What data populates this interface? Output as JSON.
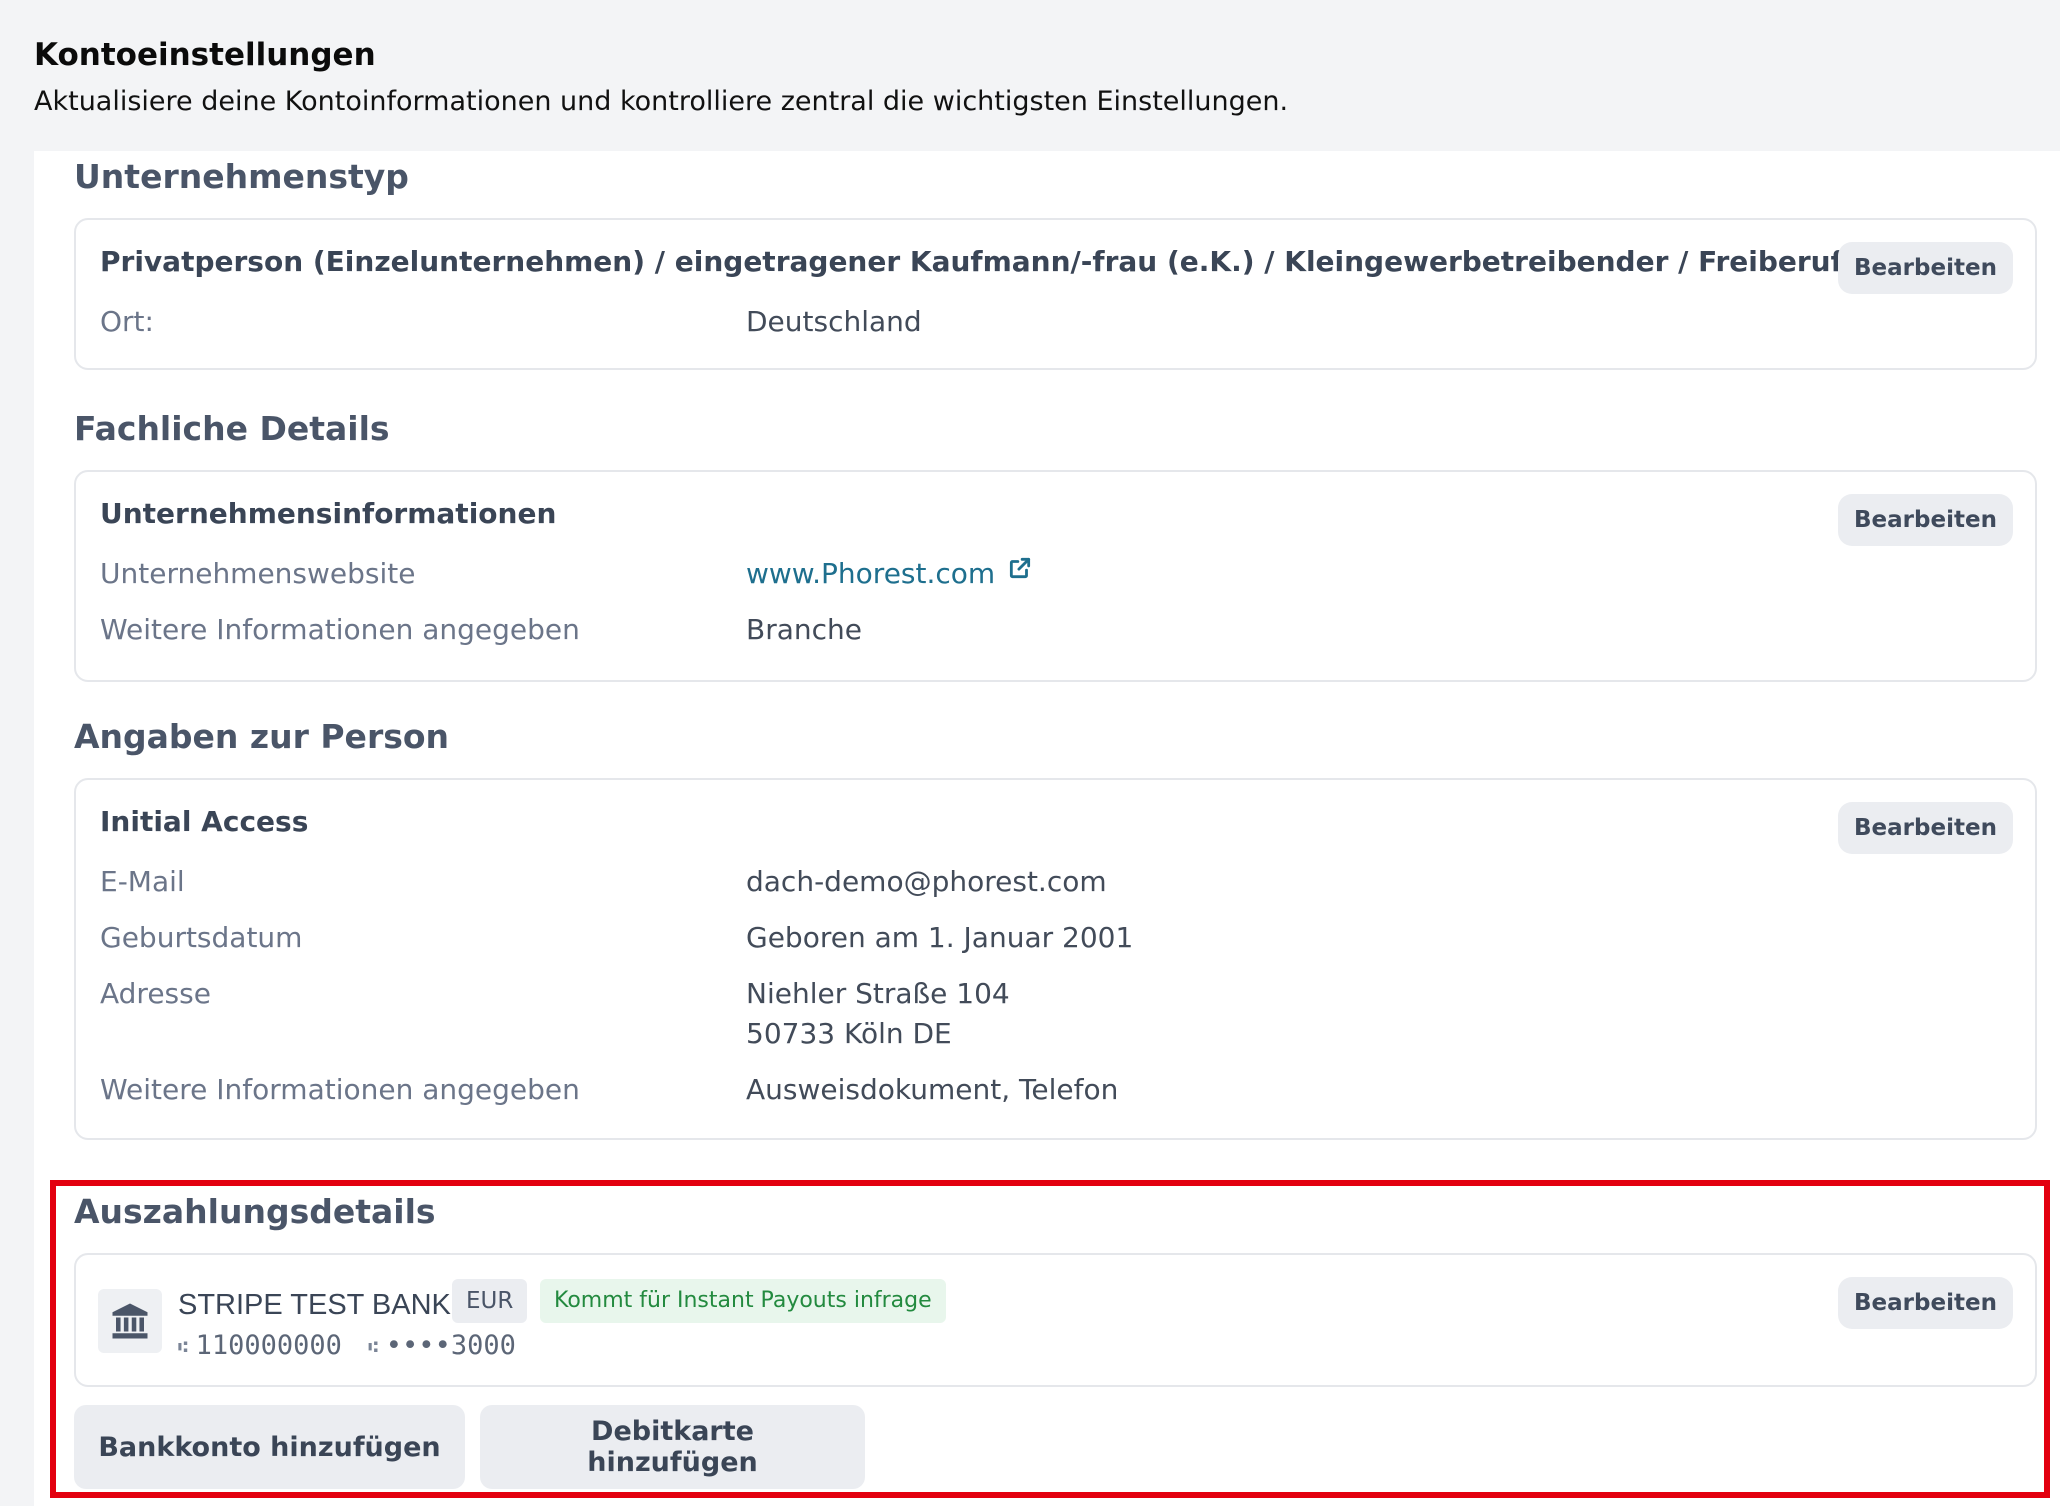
{
  "header": {
    "title": "Kontoeinstellungen",
    "subtitle": "Aktualisiere deine Kontoinformationen und kontrolliere zentral die wichtigsten Einstellungen."
  },
  "edit_label": "Bearbeiten",
  "company_type": {
    "section_title": "Unternehmenstyp",
    "heading": "Privatperson (Einzelunternehmen) / eingetragener Kaufmann/-frau (e.K.) / Kleingewerbetreibender / Freiberufler / o.ä.",
    "rows": [
      {
        "label": "Ort:",
        "value": "Deutschland"
      }
    ]
  },
  "professional_details": {
    "section_title": "Fachliche Details",
    "heading": "Unternehmensinformationen",
    "website_label": "Unternehmenswebsite",
    "website_value": "www.Phorest.com",
    "more_info_label": "Weitere Informationen angegeben",
    "more_info_value": "Branche"
  },
  "person": {
    "section_title": "Angaben zur Person",
    "heading": "Initial Access",
    "email_label": "E-Mail",
    "email_value": "dach-demo@phorest.com",
    "birth_label": "Geburtsdatum",
    "birth_value": "Geboren am 1. Januar 2001",
    "address_label": "Adresse",
    "address_line1": "Niehler Straße 104",
    "address_line2": "50733 Köln DE",
    "more_info_label": "Weitere Informationen angegeben",
    "more_info_value": "Ausweisdokument, Telefon"
  },
  "payout": {
    "section_title": "Auszahlungsdetails",
    "bank_name": "STRIPE TEST BANK",
    "currency": "EUR",
    "instant_badge": "Kommt für Instant Payouts infrage",
    "routing_number": "110000000",
    "account_masked": "••••3000",
    "add_bank_label": "Bankkonto hinzufügen",
    "add_debit_label": "Debitkarte hinzufügen"
  },
  "icons": {
    "bank": "bank-icon",
    "external_link": "external-link-icon",
    "separator": "routing-separator-icon"
  },
  "colors": {
    "highlight_border": "#e3000f",
    "link": "#1e6f8e",
    "badge_green_bg": "#e8f6ec",
    "badge_green_text": "#238a3f"
  }
}
